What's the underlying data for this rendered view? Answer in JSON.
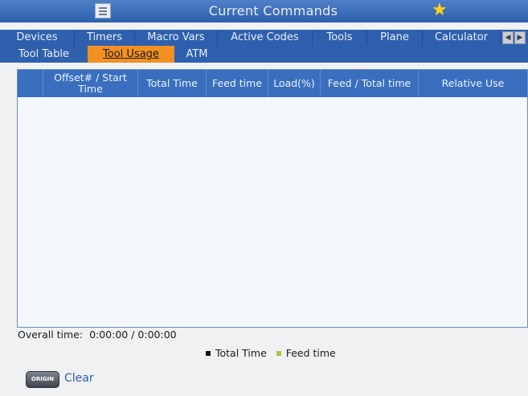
{
  "header": {
    "title": "Current Commands",
    "menu_icon": "hamburger-menu-icon",
    "favorite_icon": "star-icon",
    "favorite_color": "#ffd21a"
  },
  "tabs": [
    {
      "label": "Devices"
    },
    {
      "label": "Timers"
    },
    {
      "label": "Macro Vars"
    },
    {
      "label": "Active Codes"
    },
    {
      "label": "Tools"
    },
    {
      "label": "Plane"
    },
    {
      "label": "Calculator"
    }
  ],
  "subtabs": [
    {
      "label": "Tool Table"
    },
    {
      "label": "Tool Usage"
    },
    {
      "label": "ATM"
    }
  ],
  "active_subtab": "Tool Usage",
  "table": {
    "columns": [
      "",
      "Offset# / Start Time",
      "Total Time",
      "Feed time",
      "Load(%)",
      "Feed / Total time",
      "Relative Use"
    ]
  },
  "overall": {
    "label": "Overall time:",
    "value": "0:00:00 / 0:00:00"
  },
  "legend": [
    {
      "label": "Total Time",
      "color": "#111111"
    },
    {
      "label": "Feed time",
      "color": "#a6c93a"
    }
  ],
  "actions": {
    "origin_label": "ORIGIN",
    "clear_label": "Clear"
  },
  "colors": {
    "accent": "#f29022",
    "header": "#2f60ad"
  }
}
